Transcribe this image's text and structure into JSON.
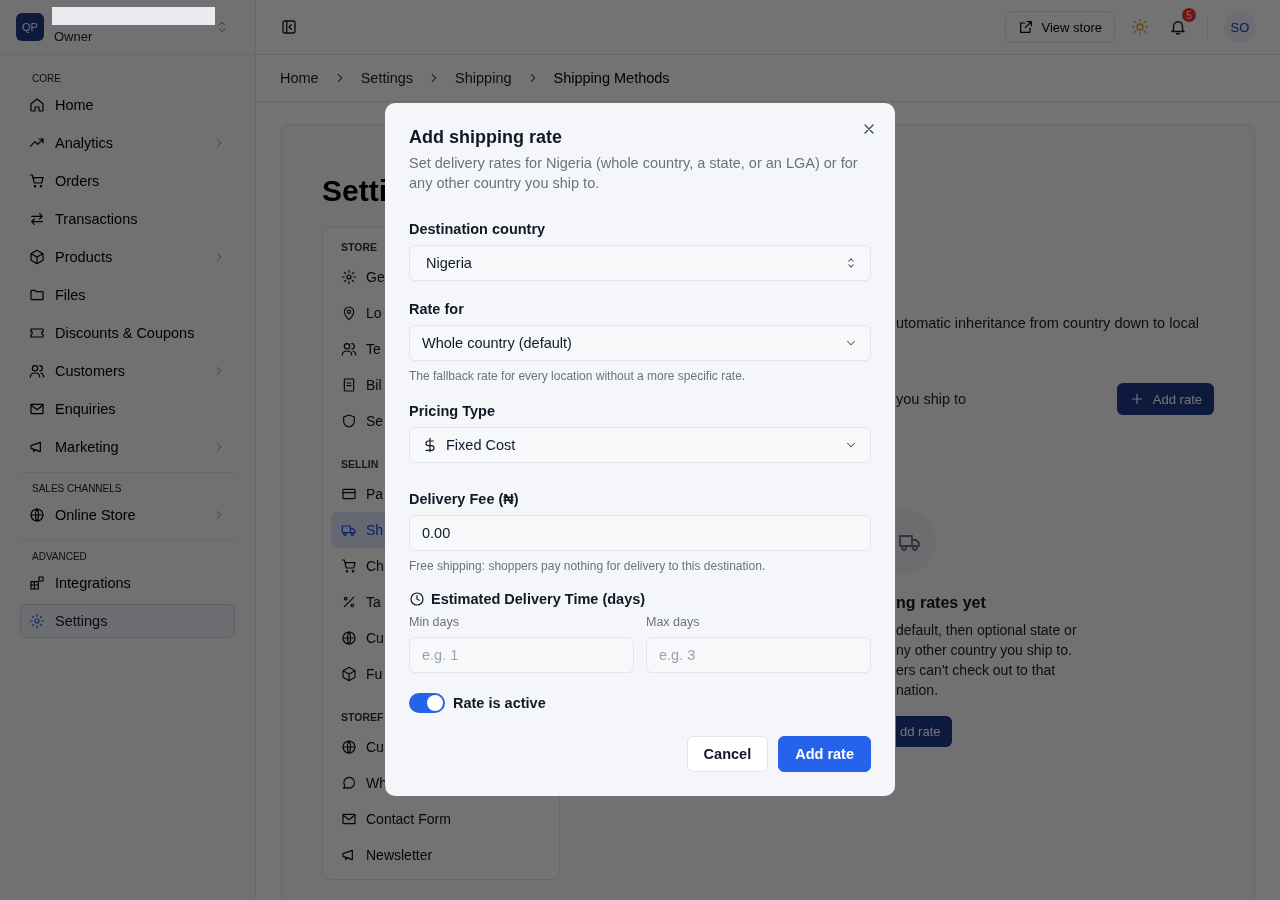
{
  "sidebar": {
    "brand": {
      "initials": "QP",
      "role": "Owner"
    },
    "sections": [
      {
        "label": "CORE",
        "items": [
          {
            "label": "Home",
            "expandable": false,
            "selected": false
          },
          {
            "label": "Analytics",
            "expandable": true,
            "selected": false
          },
          {
            "label": "Orders",
            "expandable": false,
            "selected": false
          },
          {
            "label": "Transactions",
            "expandable": false,
            "selected": false
          },
          {
            "label": "Products",
            "expandable": true,
            "selected": false
          },
          {
            "label": "Files",
            "expandable": false,
            "selected": false
          },
          {
            "label": "Discounts & Coupons",
            "expandable": false,
            "selected": false
          },
          {
            "label": "Customers",
            "expandable": true,
            "selected": false
          },
          {
            "label": "Enquiries",
            "expandable": false,
            "selected": false
          },
          {
            "label": "Marketing",
            "expandable": true,
            "selected": false
          }
        ]
      },
      {
        "label": "SALES CHANNELS",
        "items": [
          {
            "label": "Online Store",
            "expandable": true,
            "selected": false
          }
        ]
      },
      {
        "label": "ADVANCED",
        "items": [
          {
            "label": "Integrations",
            "expandable": false,
            "selected": false
          },
          {
            "label": "Settings",
            "expandable": false,
            "selected": true
          }
        ]
      }
    ]
  },
  "topbar": {
    "view_store": "View store",
    "notifications": "5",
    "avatar": "SO"
  },
  "breadcrumb": [
    "Home",
    "Settings",
    "Shipping",
    "Shipping Methods"
  ],
  "page": {
    "title": "Setti",
    "nav": [
      {
        "label": "STORE",
        "items": [
          {
            "label": "Ge",
            "selected": false
          },
          {
            "label": "Lo",
            "selected": false
          },
          {
            "label": "Te",
            "selected": false
          },
          {
            "label": "Bil",
            "selected": false
          },
          {
            "label": "Se",
            "selected": false
          }
        ]
      },
      {
        "label": "SELLIN",
        "items": [
          {
            "label": "Pa",
            "selected": false
          },
          {
            "label": "Sh",
            "selected": true
          },
          {
            "label": "Ch",
            "selected": false
          },
          {
            "label": "Ta",
            "selected": false
          },
          {
            "label": "Cu",
            "selected": false
          },
          {
            "label": "Fu",
            "selected": false
          }
        ]
      },
      {
        "label": "STOREF",
        "items": [
          {
            "label": "Cu",
            "selected": false
          },
          {
            "label": "Wh",
            "selected": false
          },
          {
            "label": "Contact Form",
            "selected": false
          },
          {
            "label": "Newsletter",
            "selected": false
          }
        ]
      }
    ],
    "intro": "utomatic inheritance from country down to local",
    "section_text": "you ship to",
    "add_rate": "Add rate",
    "empty_title": "ng rates yet",
    "empty_lines": [
      "default, then optional state or",
      "ny other country you ship to.",
      "ers can't check out to that",
      "nation."
    ],
    "empty_button": "dd rate"
  },
  "modal": {
    "title": "Add shipping rate",
    "description": "Set delivery rates for Nigeria (whole country, a state, or an LGA) or for any other country you ship to.",
    "country": {
      "label": "Destination country",
      "value": "Nigeria"
    },
    "rate_for": {
      "label": "Rate for",
      "value": "Whole country (default)",
      "hint": "The fallback rate for every location without a more specific rate."
    },
    "pricing": {
      "label": "Pricing Type",
      "value": "Fixed Cost"
    },
    "fee": {
      "label": "Delivery Fee (₦)",
      "value": "0.00",
      "hint": "Free shipping: shoppers pay nothing for delivery to this destination."
    },
    "delivery_time": {
      "label": "Estimated Delivery Time (days)",
      "min": {
        "label": "Min days",
        "placeholder": "e.g. 1"
      },
      "max": {
        "label": "Max days",
        "placeholder": "e.g. 3"
      }
    },
    "active": {
      "label": "Rate is active",
      "on": true
    },
    "buttons": [
      {
        "label": "Cancel",
        "kind": "secondary"
      },
      {
        "label": "Add rate",
        "kind": "primary"
      }
    ]
  }
}
